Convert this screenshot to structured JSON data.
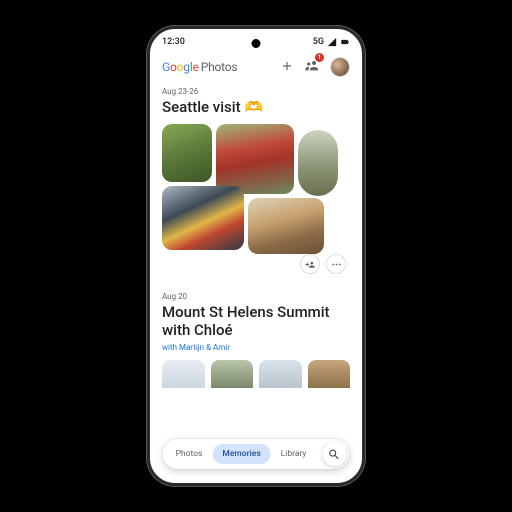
{
  "status": {
    "time": "12:30",
    "network": "5G",
    "share_badge": "1"
  },
  "brand": {
    "g": "G",
    "o1": "o",
    "o2": "o",
    "g2": "g",
    "l": "l",
    "e": "e",
    "photos": "Photos"
  },
  "memory1": {
    "date": "Aug 23-26",
    "title": "Seattle visit",
    "emoji": "🫶"
  },
  "memory2": {
    "date": "Aug 20",
    "title": "Mount St Helens Summit with Chloé",
    "with": "with Martijn & Amir"
  },
  "nav": {
    "photos": "Photos",
    "memories": "Memories",
    "library": "Library"
  }
}
